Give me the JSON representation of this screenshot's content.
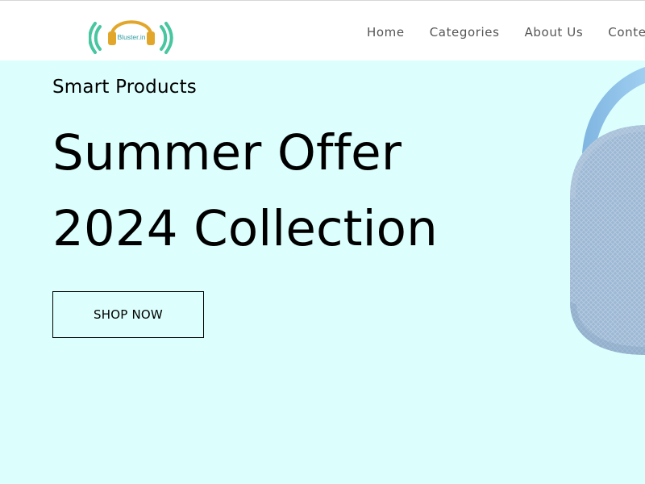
{
  "header": {
    "logo_text": "Bluster.in",
    "nav": [
      {
        "label": "Home"
      },
      {
        "label": "Categories"
      },
      {
        "label": "About Us"
      },
      {
        "label": "Conte"
      }
    ]
  },
  "hero": {
    "kicker": "Smart Products",
    "title_line_1": "Summer Offer",
    "title_line_2": "2024 Collection",
    "button_label": "SHOP NOW"
  },
  "colors": {
    "hero_background": "#dcfffd",
    "logo_headphone": "#e2a72a",
    "logo_waves": "#48c6a0",
    "speaker_fabric": "#9eb9d5",
    "speaker_strap": "#87bde6"
  },
  "icons": {
    "logo": "headphones-logo-icon",
    "product_image": "bluetooth-speaker"
  }
}
